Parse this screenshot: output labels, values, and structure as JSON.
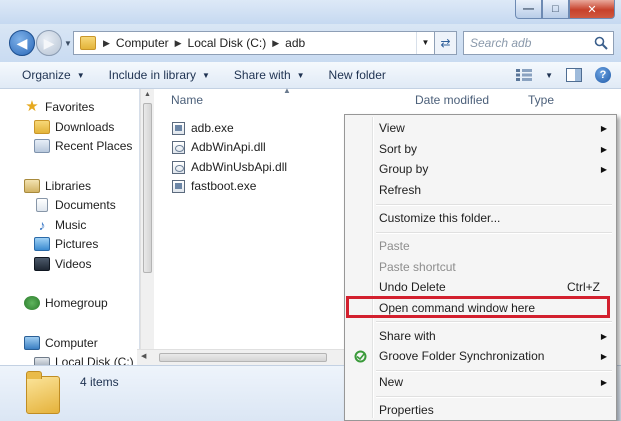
{
  "address": {
    "crumbs": [
      "Computer",
      "Local Disk (C:)",
      "adb"
    ]
  },
  "search": {
    "placeholder": "Search adb"
  },
  "toolbar": {
    "organize": "Organize",
    "include_in_library": "Include in library",
    "share_with": "Share with",
    "new_folder": "New folder"
  },
  "nav": {
    "favorites": "Favorites",
    "downloads": "Downloads",
    "recent_places": "Recent Places",
    "libraries": "Libraries",
    "documents": "Documents",
    "music": "Music",
    "pictures": "Pictures",
    "videos": "Videos",
    "homegroup": "Homegroup",
    "computer": "Computer",
    "local_disk": "Local Disk (C:)"
  },
  "columns": {
    "name": "Name",
    "date_modified": "Date modified",
    "type": "Type"
  },
  "files": [
    {
      "name": "adb.exe",
      "icon": "exe-icon"
    },
    {
      "name": "AdbWinApi.dll",
      "icon": "dll-icon"
    },
    {
      "name": "AdbWinUsbApi.dll",
      "icon": "dll-icon"
    },
    {
      "name": "fastboot.exe",
      "icon": "exe-icon"
    }
  ],
  "status": {
    "item_count": "4 items"
  },
  "context_menu": {
    "view": "View",
    "sort_by": "Sort by",
    "group_by": "Group by",
    "refresh": "Refresh",
    "customize": "Customize this folder...",
    "paste": "Paste",
    "paste_shortcut": "Paste shortcut",
    "undo_delete": "Undo Delete",
    "undo_shortcut": "Ctrl+Z",
    "open_command": "Open command window here",
    "share_with": "Share with",
    "groove": "Groove Folder Synchronization",
    "new": "New",
    "properties": "Properties"
  },
  "colors": {
    "highlight": "#d3202e",
    "accent": "#2a68b8"
  }
}
